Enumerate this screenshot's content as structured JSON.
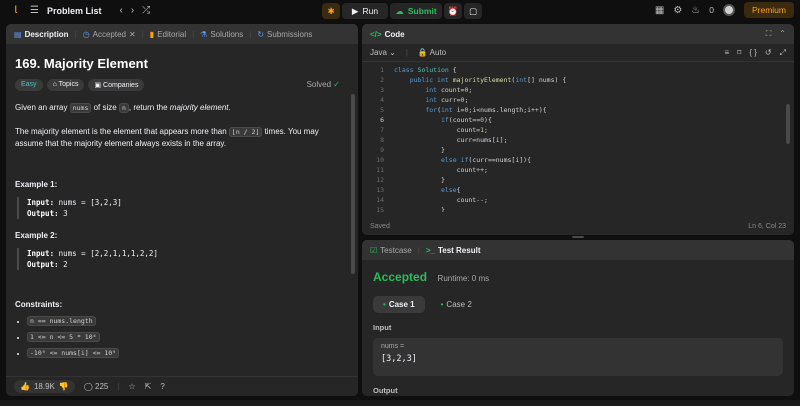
{
  "topbar": {
    "problem_list": "Problem List",
    "run": "Run",
    "submit": "Submit",
    "streak": "0",
    "premium": "Premium"
  },
  "left": {
    "tabs": [
      "Description",
      "Accepted",
      "Editorial",
      "Solutions",
      "Submissions"
    ],
    "title": "169. Majority Element",
    "solved": "Solved",
    "tags": [
      "Easy",
      "Topics",
      "Companies"
    ],
    "p1a": "Given an array",
    "p1code": "nums",
    "p1b": "of size",
    "p1code2": "n",
    "p1c": ", return the",
    "p1em": "majority element",
    "p1d": ".",
    "p2a": "The majority element is the element that appears more than",
    "p2code": "⌊n / 2⌋",
    "p2b": "times. You may assume that the majority element always exists in the array.",
    "ex1": "Example 1:",
    "ex1_in_label": "Input:",
    "ex1_in": "nums = [3,2,3]",
    "ex1_out_label": "Output:",
    "ex1_out": "3",
    "ex2": "Example 2:",
    "ex2_in_label": "Input:",
    "ex2_in": "nums = [2,2,1,1,1,2,2]",
    "ex2_out_label": "Output:",
    "ex2_out": "2",
    "constraints": "Constraints:",
    "c1": "n == nums.length",
    "c2": "1 <= n <= 5 * 10⁴",
    "c3": "-10⁹ <= nums[i] <= 10⁹",
    "likes": "18.9K",
    "comments": "225"
  },
  "code": {
    "title": "Code",
    "lang": "Java",
    "auto": "Auto",
    "saved": "Saved",
    "position": "Ln 6, Col 23",
    "lines": [
      "1",
      "2",
      "3",
      "4",
      "5",
      "6",
      "7",
      "8",
      "9",
      "10",
      "11",
      "12",
      "13",
      "14",
      "15"
    ]
  },
  "result": {
    "tabs": [
      "Testcase",
      "Test Result"
    ],
    "status": "Accepted",
    "runtime": "Runtime: 0 ms",
    "cases": [
      "Case 1",
      "Case 2"
    ],
    "input_label": "Input",
    "var": "nums =",
    "val": "[3,2,3]",
    "output_label": "Output"
  }
}
